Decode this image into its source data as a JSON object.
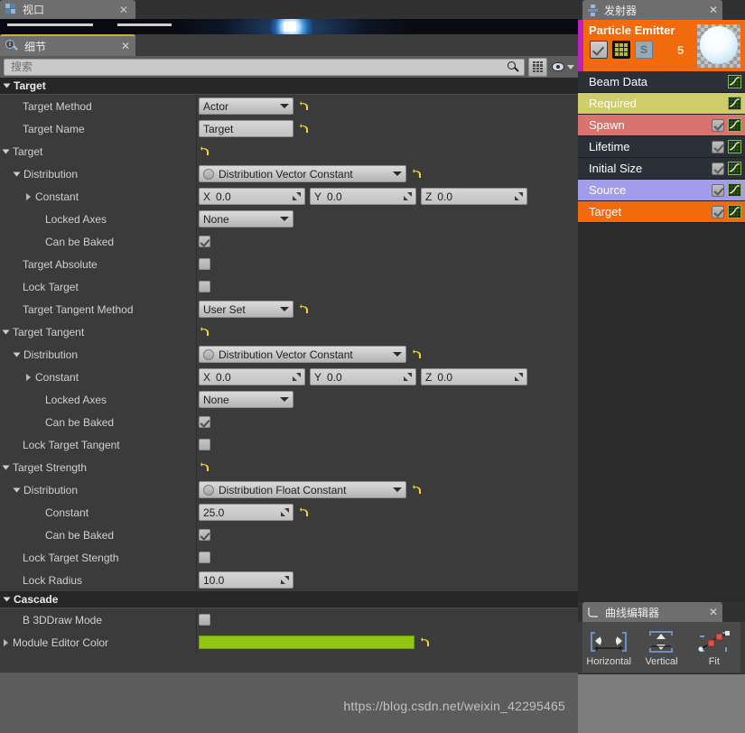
{
  "window": {
    "viewport_tab": {
      "label": "视口",
      "icon": "viewport-grid-icon",
      "close": "✕"
    },
    "details_tab": {
      "label": "细节",
      "icon": "details-magnifier-icon",
      "close": "✕"
    }
  },
  "search": {
    "placeholder": "搜索",
    "value": "",
    "icon": "search-icon",
    "grid_button": "grid-view-icon",
    "eye_button": "visibility-eye-icon"
  },
  "details": {
    "categories": [
      {
        "name": "Target",
        "rows": [
          {
            "label": "Target Method",
            "indent": 0,
            "marker": "none",
            "widget": "combo-sm",
            "value": "Actor",
            "revert": true
          },
          {
            "label": "Target Name",
            "indent": 0,
            "marker": "none",
            "widget": "text",
            "value": "Target",
            "revert": true
          },
          {
            "label": "Target",
            "indent": 0,
            "marker": "open",
            "widget": "revert-only",
            "value": "",
            "revert": true
          },
          {
            "label": "Distribution",
            "indent": 1,
            "marker": "open",
            "widget": "combo-lg",
            "value": "Distribution Vector Constant",
            "revert": true
          },
          {
            "label": "Constant",
            "indent": 2,
            "marker": "closed",
            "widget": "xyz",
            "x": "0.0",
            "y": "0.0",
            "z": "0.0"
          },
          {
            "label": "Locked Axes",
            "indent": 2,
            "marker": "none",
            "widget": "combo-sm",
            "value": "None",
            "revert": false
          },
          {
            "label": "Can be Baked",
            "indent": 2,
            "marker": "none",
            "widget": "check",
            "checked": true
          },
          {
            "label": "Target Absolute",
            "indent": 0,
            "marker": "none",
            "widget": "check",
            "checked": false
          },
          {
            "label": "Lock Target",
            "indent": 0,
            "marker": "none",
            "widget": "check",
            "checked": false
          },
          {
            "label": "Target Tangent Method",
            "indent": 0,
            "marker": "none",
            "widget": "combo-sm",
            "value": "User Set",
            "revert": true
          },
          {
            "label": "Target Tangent",
            "indent": 0,
            "marker": "open",
            "widget": "revert-only",
            "value": "",
            "revert": true
          },
          {
            "label": "Distribution",
            "indent": 1,
            "marker": "open",
            "widget": "combo-lg",
            "value": "Distribution Vector Constant",
            "revert": true
          },
          {
            "label": "Constant",
            "indent": 2,
            "marker": "closed",
            "widget": "xyz",
            "x": "0.0",
            "y": "0.0",
            "z": "0.0"
          },
          {
            "label": "Locked Axes",
            "indent": 2,
            "marker": "none",
            "widget": "combo-sm",
            "value": "None",
            "revert": false
          },
          {
            "label": "Can be Baked",
            "indent": 2,
            "marker": "none",
            "widget": "check",
            "checked": true
          },
          {
            "label": "Lock Target Tangent",
            "indent": 0,
            "marker": "none",
            "widget": "check",
            "checked": false
          },
          {
            "label": "Target Strength",
            "indent": 0,
            "marker": "open",
            "widget": "revert-only",
            "value": "",
            "revert": true
          },
          {
            "label": "Distribution",
            "indent": 1,
            "marker": "open",
            "widget": "combo-lg",
            "value": "Distribution Float Constant",
            "revert": true
          },
          {
            "label": "Constant",
            "indent": 2,
            "marker": "none",
            "widget": "num",
            "value": "25.0",
            "revert": true
          },
          {
            "label": "Can be Baked",
            "indent": 2,
            "marker": "none",
            "widget": "check",
            "checked": true
          },
          {
            "label": "Lock Target Stength",
            "indent": 0,
            "marker": "none",
            "widget": "check",
            "checked": false
          },
          {
            "label": "Lock Radius",
            "indent": 0,
            "marker": "none",
            "widget": "num",
            "value": "10.0",
            "revert": false
          }
        ]
      },
      {
        "name": "Cascade",
        "rows": [
          {
            "label": "B 3DDraw Mode",
            "indent": 0,
            "marker": "none",
            "widget": "check",
            "checked": false
          },
          {
            "label": "Module Editor Color",
            "indent": 0,
            "marker": "closed",
            "widget": "color",
            "color": "#8fc713",
            "revert": true
          }
        ]
      }
    ]
  },
  "emitter_panel": {
    "tab": {
      "label": "发射器",
      "icon": "emitter-icon",
      "close": "✕"
    },
    "header": {
      "title": "Particle Emitter",
      "count": "5",
      "stripe_color": "#c01fc0",
      "bg_color": "#f26a0c",
      "enabled_checkbox": true,
      "grid_button": "detail-mode-icon",
      "solo_button": "S",
      "thumbnail": "particle-sphere-thumbnail"
    },
    "modules": [
      {
        "name": "Beam Data",
        "bg": "#2b2f38",
        "text": "#ffffff",
        "checkbox": false,
        "curve": true
      },
      {
        "name": "Required",
        "bg": "#cfcc6b",
        "text": "#ffffff",
        "checkbox": false,
        "curve": true
      },
      {
        "name": "Spawn",
        "bg": "#d9736e",
        "text": "#ffffff",
        "checkbox": true,
        "curve": true
      },
      {
        "name": "Lifetime",
        "bg": "#2b2f38",
        "text": "#ffffff",
        "checkbox": true,
        "curve": true
      },
      {
        "name": "Initial Size",
        "bg": "#2b2f38",
        "text": "#ffffff",
        "checkbox": true,
        "curve": true
      },
      {
        "name": "Source",
        "bg": "#a39ced",
        "text": "#ffffff",
        "checkbox": true,
        "curve": true
      },
      {
        "name": "Target",
        "bg": "#f26a0c",
        "text": "#ffffff",
        "checkbox": true,
        "curve": true
      }
    ]
  },
  "curve_editor": {
    "tab": {
      "label": "曲线编辑器",
      "icon": "curve-icon",
      "close": "✕"
    },
    "tools": [
      {
        "label": "Horizontal",
        "icon": "fit-horizontal-icon"
      },
      {
        "label": "Vertical",
        "icon": "fit-vertical-icon"
      },
      {
        "label": "Fit",
        "icon": "fit-all-icon"
      }
    ]
  },
  "watermark": {
    "text": "https://blog.csdn.net/weixin_42295465"
  }
}
